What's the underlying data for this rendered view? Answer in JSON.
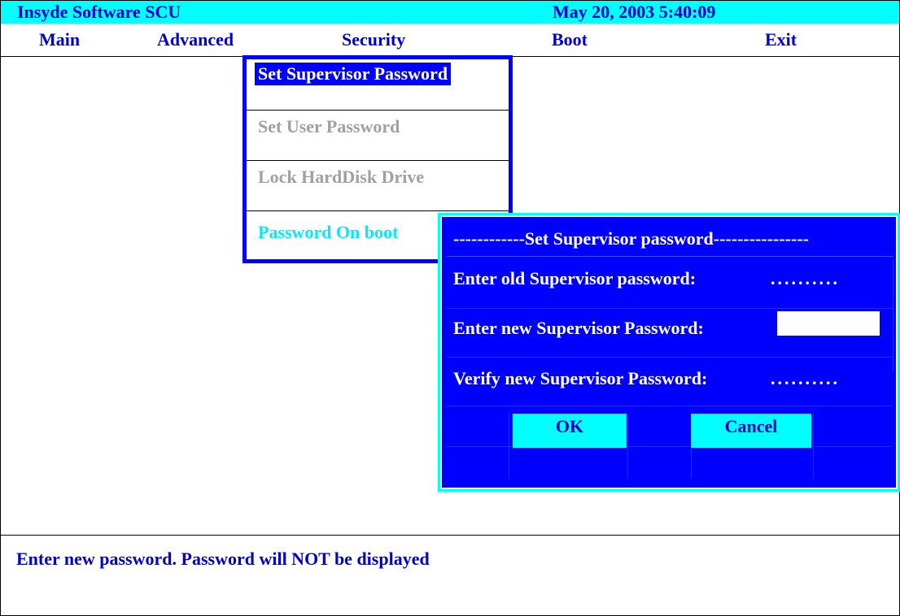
{
  "titlebar": {
    "app_title": "Insyde Software SCU",
    "datetime": "May 20, 2003 5:40:09"
  },
  "menu": {
    "items": [
      "Main",
      "Advanced",
      "Security",
      "Boot",
      "Exit"
    ]
  },
  "security_menu": {
    "items": [
      "Set Supervisor Password",
      "Set User Password",
      "Lock HardDisk Drive",
      "Password On boot"
    ]
  },
  "dialog": {
    "title": "------------Set Supervisor password----------------",
    "old_label": "Enter old Supervisor password:",
    "old_value": "..........",
    "new_label": "Enter new Supervisor Password:",
    "new_value": "",
    "verify_label": "Verify new Supervisor Password:",
    "verify_value": "..........",
    "ok_label": "OK",
    "cancel_label": "Cancel"
  },
  "status": {
    "text": "Enter new password. Password will NOT be displayed"
  },
  "colors": {
    "title_bg": "#00ffff",
    "text_blue": "#0000cc",
    "dialog_bg": "#0000ff",
    "highlight": "#00ffff",
    "disabled": "#a0a0a0"
  }
}
